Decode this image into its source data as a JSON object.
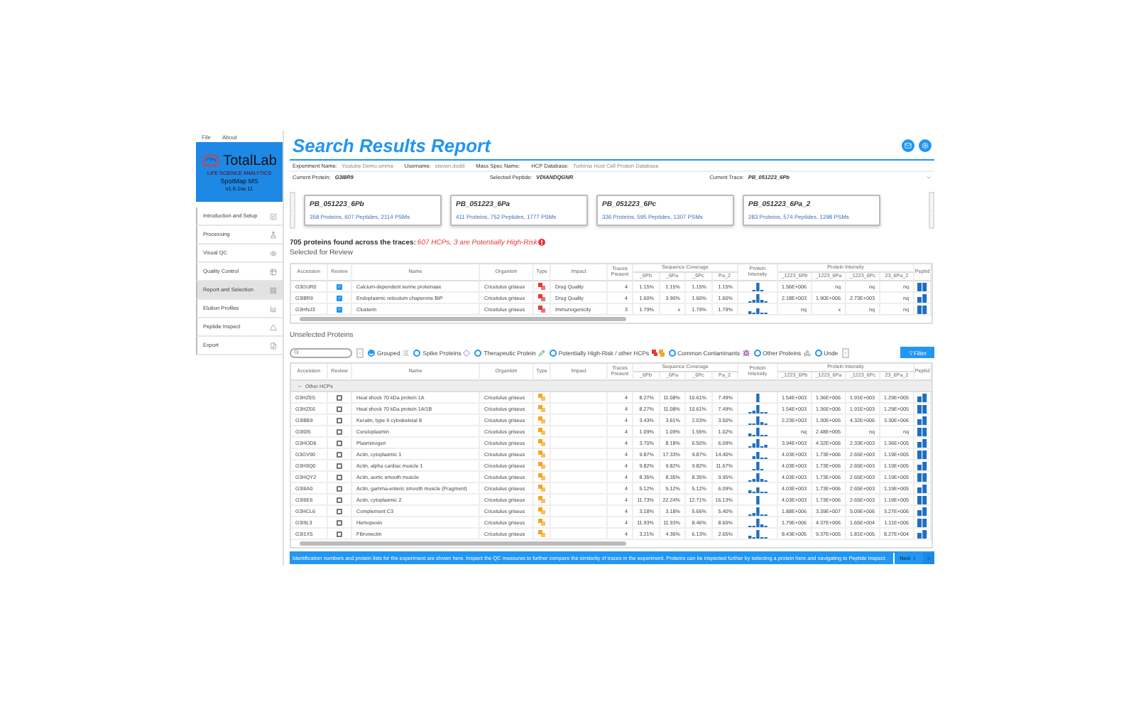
{
  "menu": [
    "File",
    "About"
  ],
  "logo": {
    "name": "TotalLab",
    "tagline": "LIFE SCIENCE ANALYTICS",
    "product": "SpotMap MS",
    "version": "v1.6.1se.11"
  },
  "sidebar": {
    "items": [
      {
        "label": "Introduction and Setup",
        "selected": false
      },
      {
        "label": "Processing",
        "selected": false
      },
      {
        "label": "Visual QC",
        "selected": false
      },
      {
        "label": "Quality Control",
        "selected": false
      },
      {
        "label": "Report and Selection",
        "selected": true
      },
      {
        "label": "Elution Profiles",
        "selected": false
      },
      {
        "label": "Peptide Inspect",
        "selected": false
      },
      {
        "label": "Export",
        "selected": false
      }
    ]
  },
  "title": "Search Results Report",
  "info": [
    {
      "label": "Experiment Name:",
      "value": "Youtube Demo.smma"
    },
    {
      "label": "Username:",
      "value": "steven.dodd"
    },
    {
      "label": "Mass Spec Name:"
    },
    {
      "label": "HCP Database:",
      "value": "Turbinia Host Cell Protein Database"
    }
  ],
  "current": {
    "protein": {
      "label": "Current Protein:",
      "value": "G3I8R9"
    },
    "peptide": {
      "label": "Selected Peptide:",
      "value": "VDIANDQGNR"
    },
    "trace": {
      "label": "Current Trace:",
      "value": "PB_051223_6Pb"
    }
  },
  "traces": [
    {
      "name": "PB_051223_6Pb",
      "stats": "358 Proteins, 607 Peptides, 2114 PSMs"
    },
    {
      "name": "PB_051223_6Pa",
      "stats": "411 Proteins, 752 Peptides, 1777 PSMs"
    },
    {
      "name": "PB_051223_6Pc",
      "stats": "336 Proteins, 595 Peptides, 1307 PSMs"
    },
    {
      "name": "PB_051223_6Pa_2",
      "stats": "283 Proteins, 574 Peptides, 1298 PSMs"
    }
  ],
  "summary": {
    "text": "705 proteins found across the traces:",
    "highlight": "607 HCPs, 3 are Potentially High-Risk"
  },
  "selected_table": {
    "title": "Selected for Review",
    "columns": [
      {
        "label": "Accession"
      },
      {
        "label": "Review"
      },
      {
        "label": "Name"
      },
      {
        "label": "Organism"
      },
      {
        "label": "Type"
      },
      {
        "label": "Impact"
      },
      {
        "label": "Traces Present"
      },
      {
        "label": "Sequence Coverage",
        "subcolumns": [
          "_6Pb",
          "_6Pa",
          "_6Pc",
          "Pa_2"
        ]
      },
      {
        "label": "Protein Intensity"
      },
      {
        "label": "Protein Intensity",
        "subcolumns": [
          "_1223_6Pb",
          "_1223_6Pa",
          "_1223_6Pc",
          "23_6Pa_2"
        ]
      },
      {
        "label": "Peptid"
      }
    ],
    "rows": [
      {
        "accession": "G3GUR0",
        "review": true,
        "name": "Calcium-dependent serine proteinase",
        "organism": "Cricetulus griseus",
        "kind": "high-risk",
        "impact": "Drug Quality",
        "traces": "4",
        "coverage": [
          "1.15%",
          "1.15%",
          "1.15%",
          "1.15%"
        ],
        "intensity": [
          "1.56E+006",
          "nq",
          "nq",
          "nq"
        ]
      },
      {
        "accession": "G3I8R9",
        "review": true,
        "name": "Endoplasmic reticulum chaperone BiP",
        "organism": "Cricetulus griseus",
        "kind": "high-risk",
        "impact": "Drug Quality",
        "traces": "4",
        "coverage": [
          "1.60%",
          "3.90%",
          "1.60%",
          "1.60%"
        ],
        "intensity": [
          "2.18E+003",
          "1.90E+006",
          "2.73E+003",
          "nq"
        ]
      },
      {
        "accession": "G3HNJ3",
        "review": true,
        "name": "Clusterin",
        "organism": "Cricetulus griseus",
        "kind": "high-risk",
        "impact": "Immunogenicity",
        "traces": "3",
        "coverage": [
          "1.79%",
          "x",
          "1.79%",
          "1.79%"
        ],
        "intensity": [
          "nq",
          "x",
          "nq",
          "nq"
        ]
      }
    ]
  },
  "unselected_table": {
    "title": "Unselected Proteins",
    "filters": [
      {
        "label": "Grouped",
        "kind": "grouped",
        "selected": true
      },
      {
        "label": "Spike Proteins",
        "kind": "spike",
        "selected": false
      },
      {
        "label": "Therapeutic Protein",
        "kind": "therapeutic",
        "selected": false
      },
      {
        "label": "Potentially High-Risk / other HCPs",
        "kind": "high-risk",
        "selected": false
      },
      {
        "label": "Common Contaminants",
        "kind": "contaminant",
        "selected": false
      },
      {
        "label": "Other Proteins",
        "kind": "other",
        "selected": false
      },
      {
        "label": "Unde",
        "kind": "undefined",
        "selected": false
      }
    ],
    "filter_button": "Filter",
    "columns": [
      {
        "label": "Accession"
      },
      {
        "label": "Review"
      },
      {
        "label": "Name"
      },
      {
        "label": "Organism"
      },
      {
        "label": "Type"
      },
      {
        "label": "Impact"
      },
      {
        "label": "Traces Present"
      },
      {
        "label": "Sequence Coverage",
        "subcolumns": [
          "_6Pb",
          "_6Pa",
          "_6Pc",
          "Pa_2"
        ]
      },
      {
        "label": "Protein Intensity"
      },
      {
        "label": "Protein Intensity",
        "subcolumns": [
          "_1223_6Pb",
          "_1223_6Pa",
          "_1223_6Pc",
          "23_6Pa_2"
        ]
      },
      {
        "label": "Peptid"
      }
    ],
    "group": {
      "label": "Other HCPs",
      "expanded": true
    },
    "rows": [
      {
        "accession": "G3HZE5",
        "review": false,
        "name": "Heat shock 70 kDa protein 1A",
        "organism": "Cricetulus griseus",
        "kind": "other-hcp",
        "traces": "4",
        "coverage": [
          "8.27%",
          "11.08%",
          "10.61%",
          "7.49%"
        ],
        "intensity": [
          "1.54E+003",
          "1.36E+006",
          "1.91E+003",
          "1.29E+005"
        ]
      },
      {
        "accession": "G3HZE6",
        "review": false,
        "name": "Heat shock 70 kDa protein 1A/1B",
        "organism": "Cricetulus griseus",
        "kind": "other-hcp",
        "traces": "4",
        "coverage": [
          "8.27%",
          "11.08%",
          "10.61%",
          "7.49%"
        ],
        "intensity": [
          "1.54E+003",
          "1.36E+006",
          "1.91E+003",
          "1.29E+005"
        ]
      },
      {
        "accession": "G3I8B9",
        "review": false,
        "name": "Keratin, type II cytoskeletal 8",
        "organism": "Cricetulus griseus",
        "kind": "other-hcp",
        "traces": "4",
        "coverage": [
          "3.43%",
          "3.61%",
          "2.03%",
          "3.50%"
        ],
        "intensity": [
          "2.23E+003",
          "1.30E+005",
          "4.32E+006",
          "3.30E+006"
        ]
      },
      {
        "accession": "G3I0I5",
        "review": false,
        "name": "Ceruloplasmin",
        "organism": "Cricetulus griseus",
        "kind": "other-hcp",
        "traces": "4",
        "coverage": [
          "1.09%",
          "1.09%",
          "1.55%",
          "1.02%"
        ],
        "intensity": [
          "nq",
          "2.48E+005",
          "nq",
          "nq"
        ]
      },
      {
        "accession": "G3HOD6",
        "review": false,
        "name": "Plasminogen",
        "organism": "Cricetulus griseus",
        "kind": "other-hcp",
        "traces": "4",
        "coverage": [
          "3.70%",
          "8.18%",
          "6.50%",
          "6.09%"
        ],
        "intensity": [
          "3.94E+003",
          "4.32E+006",
          "2.33E+003",
          "1.36E+005"
        ]
      },
      {
        "accession": "G3GV90",
        "review": false,
        "name": "Actin, cytoplasmic 1",
        "organism": "Cricetulus griseus",
        "kind": "other-hcp",
        "traces": "4",
        "coverage": [
          "9.87%",
          "17.33%",
          "9.87%",
          "14.40%"
        ],
        "intensity": [
          "4.03E+003",
          "1.73E+006",
          "2.65E+003",
          "1.19E+005"
        ]
      },
      {
        "accession": "G3H9Q0",
        "review": false,
        "name": "Actin, alpha cardiac muscle 1",
        "organism": "Cricetulus griseus",
        "kind": "other-hcp",
        "traces": "4",
        "coverage": [
          "9.82%",
          "9.82%",
          "9.82%",
          "11.67%"
        ],
        "intensity": [
          "4.03E+003",
          "1.73E+006",
          "2.65E+003",
          "1.19E+005"
        ]
      },
      {
        "accession": "G3HQY2",
        "review": false,
        "name": "Actin, aortic smooth muscle",
        "organism": "Cricetulus griseus",
        "kind": "other-hcp",
        "traces": "4",
        "coverage": [
          "8.35%",
          "8.35%",
          "8.35%",
          "9.95%"
        ],
        "intensity": [
          "4.03E+003",
          "1.73E+006",
          "2.65E+003",
          "1.19E+005"
        ]
      },
      {
        "accession": "G3I6A0",
        "review": false,
        "name": "Actin, gamma-enteric smooth muscle (Fragment)",
        "organism": "Cricetulus griseus",
        "kind": "other-hcp",
        "traces": "4",
        "coverage": [
          "5.12%",
          "5.12%",
          "5.12%",
          "6.09%"
        ],
        "intensity": [
          "4.03E+003",
          "1.73E+006",
          "2.65E+003",
          "1.19E+005"
        ]
      },
      {
        "accession": "G3I6E6",
        "review": false,
        "name": "Actin, cytoplasmic 2",
        "organism": "Cricetulus griseus",
        "kind": "other-hcp",
        "traces": "4",
        "coverage": [
          "11.73%",
          "22.24%",
          "12.71%",
          "16.13%"
        ],
        "intensity": [
          "4.03E+003",
          "1.73E+006",
          "2.65E+003",
          "1.19E+005"
        ]
      },
      {
        "accession": "G3HCL6",
        "review": false,
        "name": "Complement C3",
        "organism": "Cricetulus griseus",
        "kind": "other-hcp",
        "traces": "4",
        "coverage": [
          "3.18%",
          "3.18%",
          "5.66%",
          "5.40%"
        ],
        "intensity": [
          "1.88E+006",
          "3.39E+007",
          "5.09E+006",
          "3.27E+006"
        ]
      },
      {
        "accession": "G3I9L3",
        "review": false,
        "name": "Hemopexin",
        "organism": "Cricetulus griseus",
        "kind": "other-hcp",
        "traces": "4",
        "coverage": [
          "11.93%",
          "11.93%",
          "8.46%",
          "8.60%"
        ],
        "intensity": [
          "1.79E+006",
          "4.37E+006",
          "1.65E+004",
          "1.11E+006"
        ]
      },
      {
        "accession": "G3I1X5",
        "review": false,
        "name": "Fibronectin",
        "organism": "Cricetulus griseus",
        "kind": "other-hcp",
        "traces": "4",
        "coverage": [
          "3.21%",
          "4.36%",
          "6.13%",
          "2.65%"
        ],
        "intensity": [
          "8.43E+005",
          "9.37E+005",
          "1.81E+005",
          "8.27E+004"
        ]
      }
    ]
  },
  "status_bar": {
    "text": "Identification numbers and protein lists for the experiment are shown here. Inspect the QC measures to further compare the similarity of traces in the experiment. Proteins can be inspected further by selecting a protein here and navigating to Peptide Inspect.",
    "next": "Next"
  }
}
